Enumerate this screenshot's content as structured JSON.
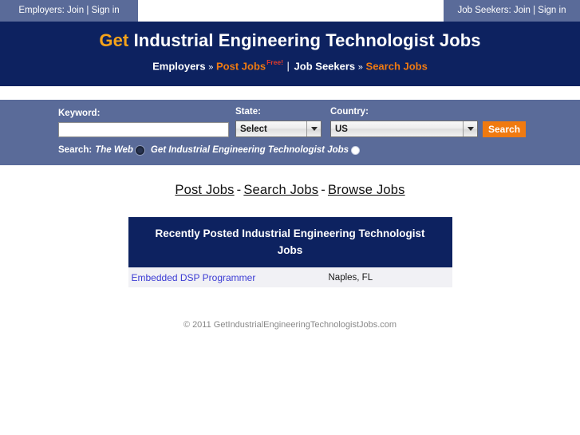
{
  "topbar": {
    "employers": {
      "prefix": "Employers:",
      "join": "Join",
      "divider": "|",
      "signin": "Sign in",
      "full": "Employers: Join | Sign in"
    },
    "job_seekers": {
      "prefix": "Job Seekers:",
      "join": "Join",
      "divider": "|",
      "signin": "Sign in",
      "full": "Job Seekers: Join | Sign in"
    }
  },
  "banner": {
    "title_accent": "Get",
    "title_rest": "Industrial Engineering Technologist Jobs",
    "accent_color": "#f5a31a",
    "background_color": "#0d2260",
    "sub": {
      "employers_label": "Employers",
      "chevron": "»",
      "post_jobs": "Post Jobs",
      "free_badge": "Free!",
      "separator": "|",
      "job_seekers_label": "Job Seekers",
      "chevron2": "»",
      "search_jobs": "Search Jobs"
    }
  },
  "search": {
    "background_color": "#5a6b99",
    "keyword_label": "Keyword:",
    "keyword_value": "",
    "keyword_placeholder": "",
    "state_label": "State:",
    "state_value": "Select",
    "country_label": "Country:",
    "country_value": "US",
    "button_label": "Search",
    "button_color": "#f07a10",
    "scope_label": "Search:",
    "scope_option_web": "The Web",
    "scope_option_site": "Get Industrial Engineering Technologist Jobs",
    "scope_selected": "Get Industrial Engineering Technologist Jobs"
  },
  "quicknav": {
    "post_jobs": "Post Jobs",
    "sep1": "-",
    "search_jobs": "Search Jobs",
    "sep2": "-",
    "browse_jobs": "Browse Jobs"
  },
  "panel": {
    "heading": "Recently Posted Industrial Engineering Technologist Jobs",
    "jobs": [
      {
        "title": "Embedded DSP Programmer",
        "location": "Naples, FL"
      }
    ]
  },
  "footer": {
    "copyright": "© 2011 GetIndustrialEngineeringTechnologistJobs.com"
  }
}
